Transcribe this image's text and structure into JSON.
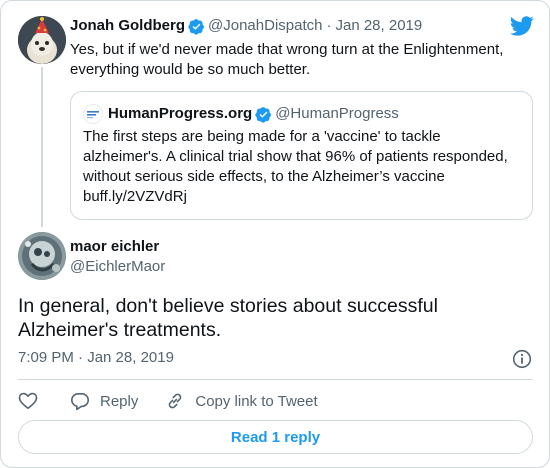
{
  "parent_tweet": {
    "author_name": "Jonah Goldberg",
    "author_handle": "@JonahDispatch",
    "separator": "·",
    "date": "Jan 28, 2019",
    "text": "Yes, but if we'd never made that wrong turn at the Enlightenment, everything would be so much better."
  },
  "quoted_tweet": {
    "author_name": "HumanProgress.org",
    "author_handle": "@HumanProgress",
    "text": "The first steps are being made for a 'vaccine' to tackle alzheimer's. A clinical trial show that 96% of patients responded, without serious side effects, to the Alzheimer’s vaccine buff.ly/2VZVdRj"
  },
  "main_tweet": {
    "author_name": "maor eichler",
    "author_handle": "@EichlerMaor",
    "text": "In general, don't believe stories about successful Alzheimer's treatments.",
    "timestamp": "7:09 PM · Jan 28, 2019"
  },
  "actions": {
    "reply_label": "Reply",
    "copy_link_label": "Copy link to Tweet"
  },
  "read_replies_label": "Read 1 reply",
  "colors": {
    "accent": "#1d9bf0",
    "text_primary": "#0f1419",
    "text_secondary": "#536471",
    "border": "#cfd9de"
  },
  "icons": {
    "twitter": "twitter-bird-icon",
    "verified": "verified-badge-icon",
    "info": "info-icon",
    "like": "heart-icon",
    "reply": "reply-bubble-icon",
    "copy_link": "link-icon"
  }
}
